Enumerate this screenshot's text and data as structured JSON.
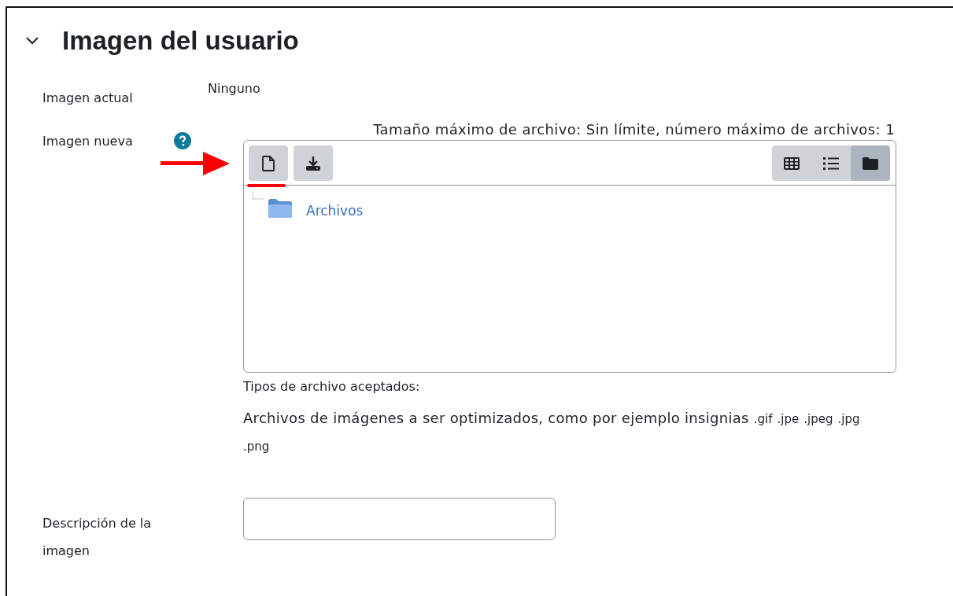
{
  "section": {
    "title": "Imagen del usuario",
    "expanded": true
  },
  "current_image": {
    "label": "Imagen actual",
    "value": "Ninguno"
  },
  "new_image": {
    "label": "Imagen nueva",
    "limits": "Tamaño máximo de archivo: Sin límite, número máximo de archivos: 1",
    "tools": [
      {
        "kind": "add"
      },
      {
        "kind": "download"
      }
    ],
    "views": [
      {
        "kind": "grid",
        "selected": false
      },
      {
        "kind": "list",
        "selected": false
      },
      {
        "kind": "tree",
        "selected": true
      }
    ],
    "tree": [
      {
        "label": "Archivos"
      }
    ]
  },
  "accepted_types": {
    "label": "Tipos de archivo aceptados:",
    "description": "Archivos de imágenes a ser optimizados, como por ejemplo insignias",
    "extensions": [
      ".gif",
      ".jpe",
      ".jpeg",
      ".jpg",
      ".png"
    ]
  },
  "description_field": {
    "label": "Descripción de la imagen"
  }
}
